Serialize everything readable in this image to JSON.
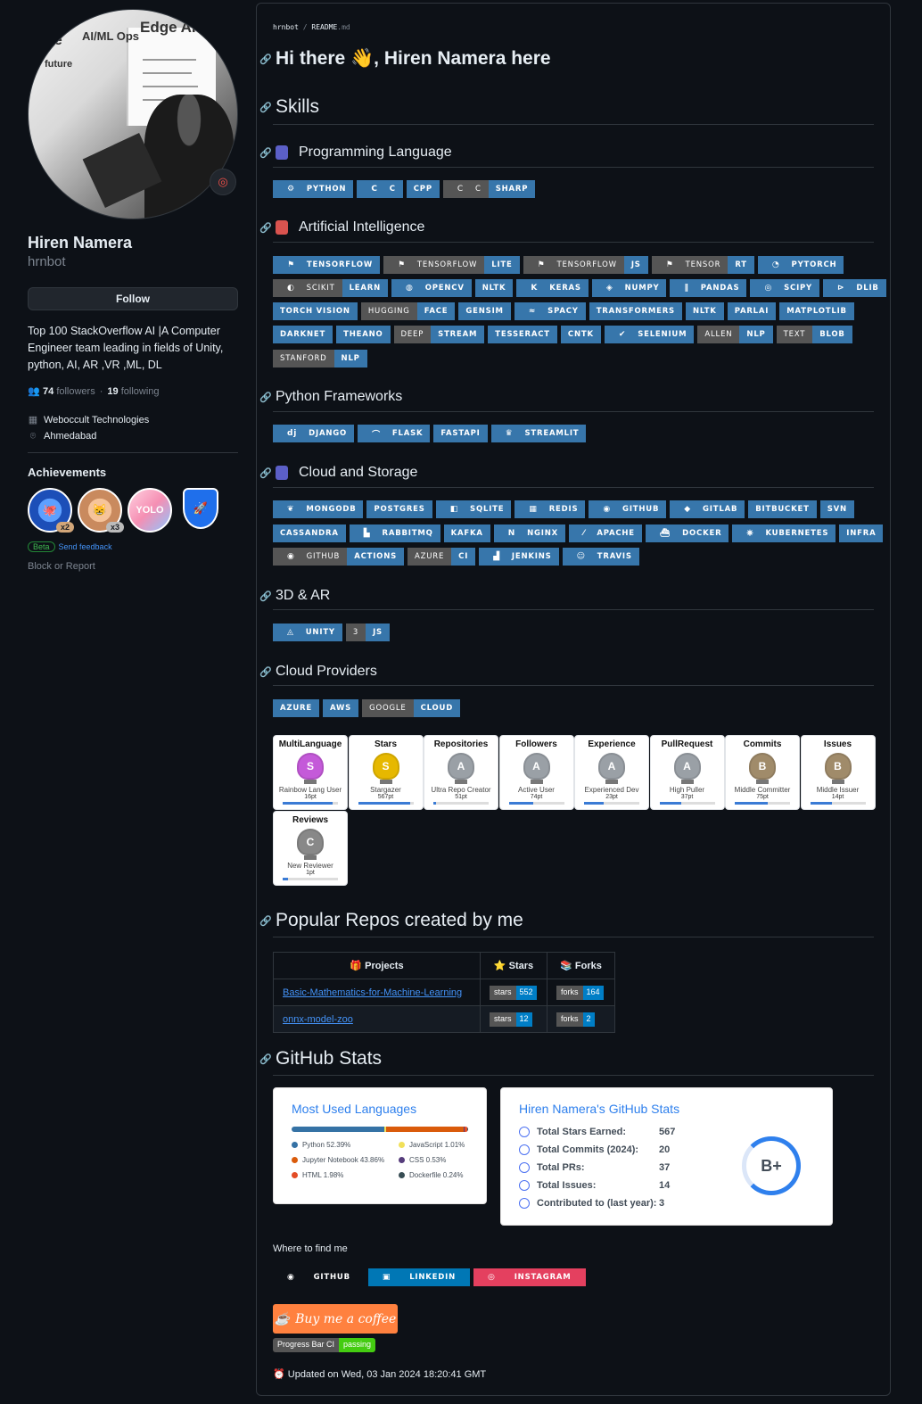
{
  "profile": {
    "name": "Hiren Namera",
    "login": "hrnbot",
    "follow": "Follow",
    "bio": "Top 100 StackOverflow AI |A Computer Engineer team leading in fields of Unity, python, AI, AR ,VR ,ML, DL",
    "followers": "74",
    "followers_label": "followers",
    "dot": "·",
    "following": "19",
    "following_label": "following",
    "company": "Weboccult Technologies",
    "location": "Ahmedabad",
    "achievements_title": "Achievements",
    "beta": "Beta",
    "feedback": "Send feedback",
    "block": "Block or Report",
    "avatar_text": {
      "a": "AI/ML Ops",
      "b": "Edge AI",
      "c": "future",
      "d": "se"
    }
  },
  "badges": [
    {
      "count": "x2",
      "color": "#2b6fe0"
    },
    {
      "count": "x3",
      "color": "#e9a06a"
    },
    {
      "count": "",
      "color": "#f4a6c0",
      "text": "YOLO"
    },
    {
      "count": "",
      "color": "#1f6feb"
    }
  ],
  "crumb": {
    "user": "hrnbot",
    "sep": "/",
    "file": "README",
    "ext": ".md"
  },
  "headings": {
    "hi": "Hi there 👋, Hiren Namera here",
    "skills": "Skills",
    "prog": "Programming Language",
    "ai": "Artificial Intelligence",
    "pyfw": "Python Frameworks",
    "cloud": "Cloud and Storage",
    "ar": "3D & AR",
    "providers": "Cloud Providers",
    "repos": "Popular Repos created by me",
    "stats": "GitHub Stats"
  },
  "badge_rows": {
    "prog": [
      [
        "PYTHON"
      ],
      [
        "C"
      ],
      [
        "CPP"
      ],
      [
        "C",
        "SHARP"
      ]
    ],
    "ai1": [
      [
        "TENSORFLOW"
      ],
      [
        "TENSORFLOW",
        "LITE"
      ],
      [
        "TENSORFLOW",
        "JS"
      ],
      [
        "TENSOR",
        "RT"
      ],
      [
        "PYTORCH"
      ]
    ],
    "ai2": [
      [
        "SCIKIT",
        "LEARN"
      ],
      [
        "OPENCV"
      ],
      [
        "NLTK"
      ],
      [
        "KERAS"
      ],
      [
        "NUMPY"
      ],
      [
        "PANDAS"
      ],
      [
        "SCIPY"
      ],
      [
        "DLIB"
      ]
    ],
    "ai3": [
      [
        "TORCH VISION"
      ],
      [
        "HUGGING",
        "FACE"
      ],
      [
        "GENSIM"
      ],
      [
        "SPACY"
      ],
      [
        "TRANSFORMERS"
      ],
      [
        "NLTK"
      ],
      [
        "PARLAI"
      ],
      [
        "MATPLOTLIB"
      ]
    ],
    "ai4": [
      [
        "DARKNET"
      ],
      [
        "THEANO"
      ],
      [
        "DEEP",
        "STREAM"
      ],
      [
        "TESSERACT"
      ],
      [
        "CNTK"
      ],
      [
        "SELENIUM"
      ],
      [
        "ALLEN",
        "NLP"
      ],
      [
        "TEXT",
        "BLOB"
      ]
    ],
    "ai5": [
      [
        "STANFORD",
        "NLP"
      ]
    ],
    "pyfw": [
      [
        "DJANGO"
      ],
      [
        "FLASK"
      ],
      [
        "FASTAPI"
      ],
      [
        "STREAMLIT"
      ]
    ],
    "cl1": [
      [
        "MONGODB"
      ],
      [
        "POSTGRES"
      ],
      [
        "SQLITE"
      ],
      [
        "REDIS"
      ],
      [
        "GITHUB"
      ],
      [
        "GITLAB"
      ],
      [
        "BITBUCKET"
      ],
      [
        "SVN"
      ]
    ],
    "cl2": [
      [
        "CASSANDRA"
      ],
      [
        "RABBITMQ"
      ],
      [
        "KAFKA"
      ],
      [
        "NGINX"
      ],
      [
        "APACHE"
      ],
      [
        "DOCKER"
      ],
      [
        "KUBERNETES"
      ],
      [
        "INFRA"
      ]
    ],
    "cl3": [
      [
        "GITHUB",
        "ACTIONS"
      ],
      [
        "AZURE",
        "CI"
      ],
      [
        "JENKINS"
      ],
      [
        "TRAVIS"
      ]
    ],
    "ar": [
      [
        "UNITY"
      ],
      [
        "3",
        "JS"
      ]
    ],
    "prov": [
      [
        "AZURE"
      ],
      [
        "AWS"
      ],
      [
        "GOOGLE",
        "CLOUD"
      ]
    ]
  },
  "trophies": [
    {
      "title": "MultiLanguage",
      "rank": "S",
      "name": "Rainbow Lang User",
      "pts": "16pt",
      "fill": 0.9,
      "color": "#c45ad9"
    },
    {
      "title": "Stars",
      "rank": "S",
      "name": "Stargazer",
      "pts": "567pt",
      "fill": 0.95,
      "color": "#e6b800"
    },
    {
      "title": "Repositories",
      "rank": "A",
      "name": "Ultra Repo Creator",
      "pts": "51pt",
      "fill": 0.05,
      "color": "#9aa0a6"
    },
    {
      "title": "Followers",
      "rank": "A",
      "name": "Active User",
      "pts": "74pt",
      "fill": 0.45,
      "color": "#9aa0a6"
    },
    {
      "title": "Experience",
      "rank": "A",
      "name": "Experienced Dev",
      "pts": "23pt",
      "fill": 0.35,
      "color": "#9aa0a6"
    },
    {
      "title": "PullRequest",
      "rank": "A",
      "name": "High Puller",
      "pts": "37pt",
      "fill": 0.4,
      "color": "#9aa0a6"
    },
    {
      "title": "Commits",
      "rank": "B",
      "name": "Middle Committer",
      "pts": "75pt",
      "fill": 0.6,
      "color": "#a08b6a"
    },
    {
      "title": "Issues",
      "rank": "B",
      "name": "Middle Issuer",
      "pts": "14pt",
      "fill": 0.4,
      "color": "#a08b6a"
    },
    {
      "title": "Reviews",
      "rank": "C",
      "name": "New Reviewer",
      "pts": "1pt",
      "fill": 0.1,
      "color": "#888"
    }
  ],
  "repo_table": {
    "h_projects": "🎁 Projects",
    "h_stars": "⭐ Stars",
    "h_forks": "📚 Forks",
    "rows": [
      {
        "name": "Basic-Mathematics-for-Machine-Learning",
        "stars_l": "stars",
        "stars": "552",
        "forks_l": "forks",
        "forks": "164"
      },
      {
        "name": "onnx-model-zoo",
        "stars_l": "stars",
        "stars": "12",
        "forks_l": "forks",
        "forks": "2"
      }
    ]
  },
  "langs": {
    "title": "Most Used Languages",
    "items": [
      {
        "n": "Python 52.39%",
        "c": "#3572A5",
        "p": 52.39
      },
      {
        "n": "JavaScript 1.01%",
        "c": "#f1e05a",
        "p": 1.01
      },
      {
        "n": "Jupyter Notebook 43.86%",
        "c": "#DA5B0B",
        "p": 43.86
      },
      {
        "n": "CSS 0.53%",
        "c": "#563d7c",
        "p": 0.53
      },
      {
        "n": "HTML 1.98%",
        "c": "#e34c26",
        "p": 1.98
      },
      {
        "n": "Dockerfile 0.24%",
        "c": "#384d54",
        "p": 0.24
      }
    ]
  },
  "stats": {
    "title": "Hiren Namera's GitHub Stats",
    "rows": [
      {
        "k": "Total Stars Earned:",
        "v": "567"
      },
      {
        "k": "Total Commits (2024):",
        "v": "20"
      },
      {
        "k": "Total PRs:",
        "v": "37"
      },
      {
        "k": "Total Issues:",
        "v": "14"
      },
      {
        "k": "Contributed to (last year):",
        "v": "3"
      }
    ],
    "rank": "B+"
  },
  "find": {
    "label": "Where to find me",
    "github": "GITHUB",
    "linkedin": "LINKEDIN",
    "instagram": "INSTAGRAM",
    "coffee": "Buy me a coffee",
    "ci_l": "Progress Bar CI",
    "ci_r": "passing"
  },
  "updated": "⏰ Updated on Wed, 03 Jan 2024 18:20:41 GMT"
}
